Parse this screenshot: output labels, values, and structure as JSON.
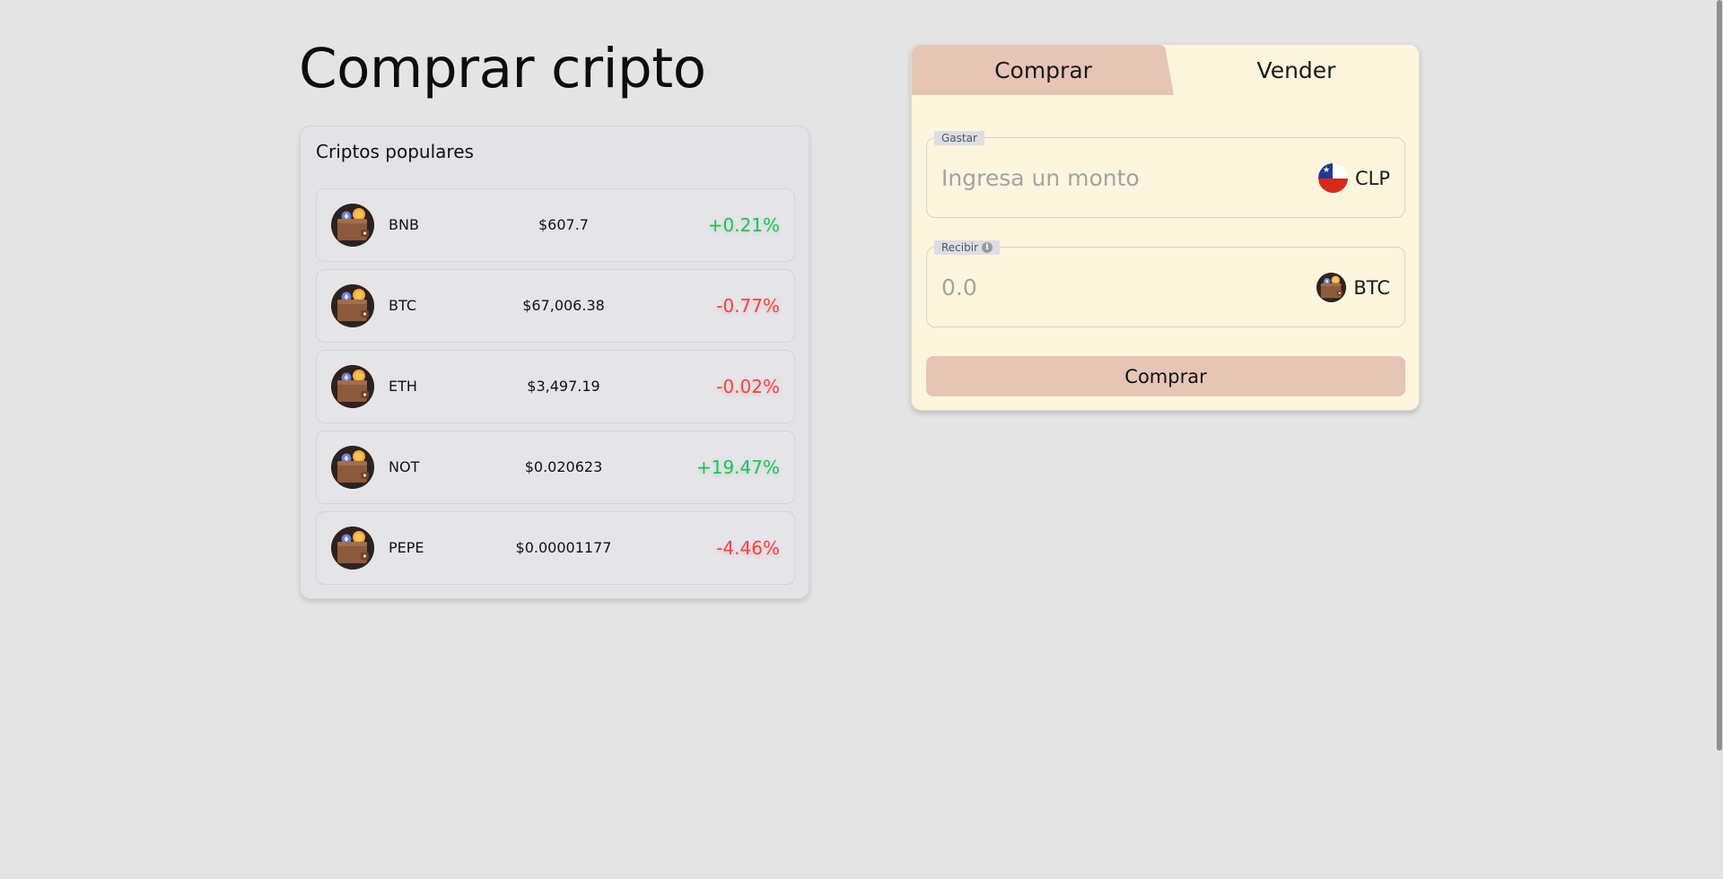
{
  "page": {
    "title": "Comprar cripto"
  },
  "popular": {
    "title": "Criptos populares",
    "coins": [
      {
        "symbol": "BNB",
        "price": "$607.7",
        "change": "+0.21%",
        "direction": "up"
      },
      {
        "symbol": "BTC",
        "price": "$67,006.38",
        "change": "-0.77%",
        "direction": "down"
      },
      {
        "symbol": "ETH",
        "price": "$3,497.19",
        "change": "-0.02%",
        "direction": "down"
      },
      {
        "symbol": "NOT",
        "price": "$0.020623",
        "change": "+19.47%",
        "direction": "up"
      },
      {
        "symbol": "PEPE",
        "price": "$0.00001177",
        "change": "-4.46%",
        "direction": "down"
      }
    ]
  },
  "trade": {
    "tabs": {
      "buy": "Comprar",
      "sell": "Vender",
      "active": "buy"
    },
    "spend": {
      "label": "Gastar",
      "placeholder": "Ingresa un monto",
      "value": "",
      "currency": "CLP",
      "currency_icon": "chile-flag-icon"
    },
    "receive": {
      "label": "Recibir",
      "placeholder": "0.0",
      "value": "",
      "currency": "BTC",
      "currency_icon": "wallet-coin-icon"
    },
    "submit_label": "Comprar"
  },
  "colors": {
    "background": "#e5e4e5",
    "card_background": "#e3e2e6",
    "trade_background": "#fdf5de",
    "accent": "#e6c5b7",
    "positive": "#22c05a",
    "negative": "#ea4848"
  }
}
